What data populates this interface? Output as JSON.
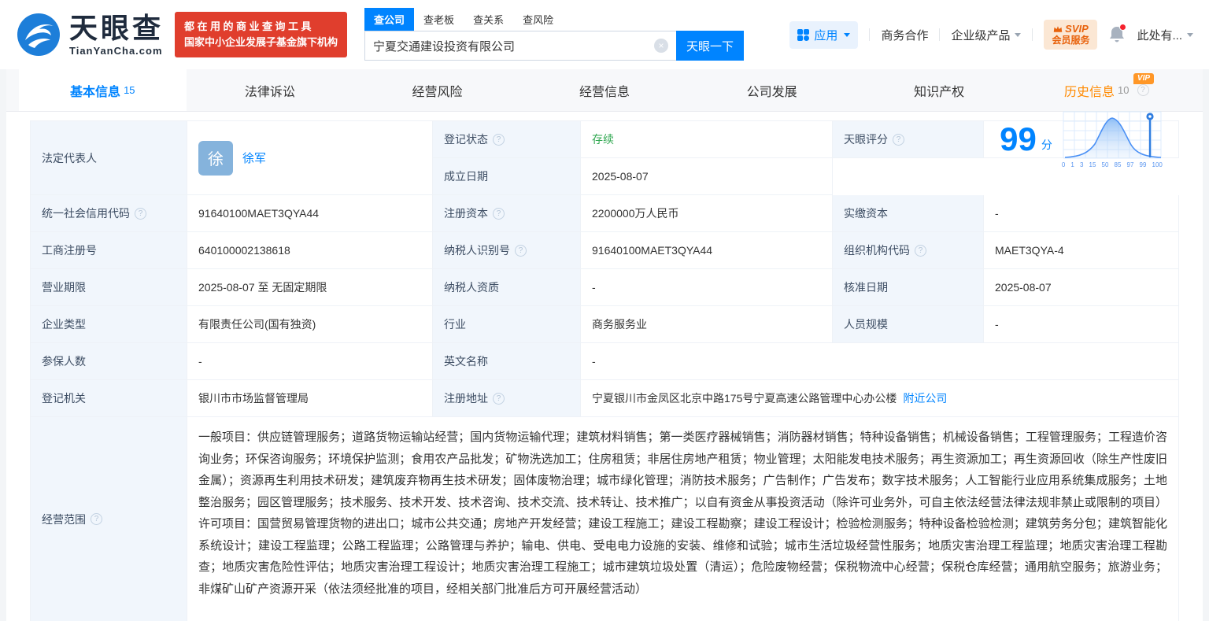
{
  "colors": {
    "brand_blue": "#0084ff",
    "status_green": "#32a852",
    "banner_red": "#e03e2d",
    "vip_orange": "#ff9727"
  },
  "header": {
    "brand": "天眼查",
    "brand_domain": "TianYanCha.com",
    "slogan_line1": "都在用的商业查询工具",
    "slogan_line2": "国家中小企业发展子基金旗下机构",
    "search": {
      "tabs": [
        {
          "label": "查公司"
        },
        {
          "label": "查老板"
        },
        {
          "label": "查关系"
        },
        {
          "label": "查风险"
        }
      ],
      "value": "宁夏交通建设投资有限公司",
      "button": "天眼一下"
    },
    "nav": {
      "apps": "应用",
      "cooperation": "商务合作",
      "enterprise": "企业级产品",
      "svip_line1": "SVIP",
      "svip_line2": "会员服务",
      "user": "此处有..."
    }
  },
  "tabbar": {
    "tabs": [
      {
        "label": "基本信息",
        "count": "15"
      },
      {
        "label": "法律诉讼"
      },
      {
        "label": "经营风险"
      },
      {
        "label": "经营信息"
      },
      {
        "label": "公司发展"
      },
      {
        "label": "知识产权"
      },
      {
        "label": "历史信息",
        "count": "10",
        "vip": "VIP"
      }
    ]
  },
  "info": {
    "legal_rep_label": "法定代表人",
    "legal_rep_avatar": "徐",
    "legal_rep_name": "徐军",
    "reg_status_label": "登记状态",
    "reg_status_value": "存续",
    "establish_date_label": "成立日期",
    "establish_date_value": "2025-08-07",
    "score_label": "天眼评分",
    "score_value": "99",
    "score_unit": "分",
    "score_axis": [
      "0",
      "1",
      "3",
      "15",
      "50",
      "85",
      "97",
      "99",
      "100"
    ],
    "credit_code_label": "统一社会信用代码",
    "credit_code_value": "91640100MAET3QYA44",
    "reg_capital_label": "注册资本",
    "reg_capital_value": "2200000万人民币",
    "paid_capital_label": "实缴资本",
    "paid_capital_value": "-",
    "reg_number_label": "工商注册号",
    "reg_number_value": "640100002138618",
    "taxpayer_id_label": "纳税人识别号",
    "taxpayer_id_value": "91640100MAET3QYA44",
    "org_code_label": "组织机构代码",
    "org_code_value": "MAET3QYA-4",
    "business_term_label": "营业期限",
    "business_term_value": "2025-08-07 至 无固定期限",
    "taxpayer_qual_label": "纳税人资质",
    "taxpayer_qual_value": "-",
    "approval_date_label": "核准日期",
    "approval_date_value": "2025-08-07",
    "company_type_label": "企业类型",
    "company_type_value": "有限责任公司(国有独资)",
    "industry_label": "行业",
    "industry_value": "商务服务业",
    "staff_size_label": "人员规模",
    "staff_size_value": "-",
    "insured_label": "参保人数",
    "insured_value": "-",
    "english_name_label": "英文名称",
    "english_name_value": "-",
    "reg_authority_label": "登记机关",
    "reg_authority_value": "银川市市场监督管理局",
    "address_label": "注册地址",
    "address_value": "宁夏银川市金凤区北京中路175号宁夏高速公路管理中心办公楼",
    "nearby_link": "附近公司",
    "scope_label": "经营范围",
    "scope_value": "一般项目：供应链管理服务；道路货物运输站经营；国内货物运输代理；建筑材料销售；第一类医疗器械销售；消防器材销售；特种设备销售；机械设备销售；工程管理服务；工程造价咨询业务；环保咨询服务；环境保护监测；食用农产品批发；矿物洗选加工；住房租赁；非居住房地产租赁；物业管理；太阳能发电技术服务；再生资源加工；再生资源回收（除生产性废旧金属）；资源再生利用技术研发；建筑废弃物再生技术研发；固体废物治理；城市绿化管理；消防技术服务；广告制作；广告发布；数字技术服务；人工智能行业应用系统集成服务；土地整治服务；园区管理服务；技术服务、技术开发、技术咨询、技术交流、技术转让、技术推广；以自有资金从事投资活动（除许可业务外，可自主依法经营法律法规非禁止或限制的项目）许可项目：国营贸易管理货物的进出口；城市公共交通；房地产开发经营；建设工程施工；建设工程勘察；建设工程设计；检验检测服务；特种设备检验检测；建筑劳务分包；建筑智能化系统设计；建设工程监理；公路工程监理；公路管理与养护；输电、供电、受电电力设施的安装、维修和试验；城市生活垃圾经营性服务；地质灾害治理工程监理；地质灾害治理工程勘查；地质灾害危险性评估；地质灾害治理工程设计；地质灾害治理工程施工；城市建筑垃圾处置（清运）；危险废物经营；保税物流中心经营；保税仓库经营；通用航空服务；旅游业务；非煤矿山矿产资源开采（依法须经批准的项目，经相关部门批准后方可开展经营活动）"
  }
}
